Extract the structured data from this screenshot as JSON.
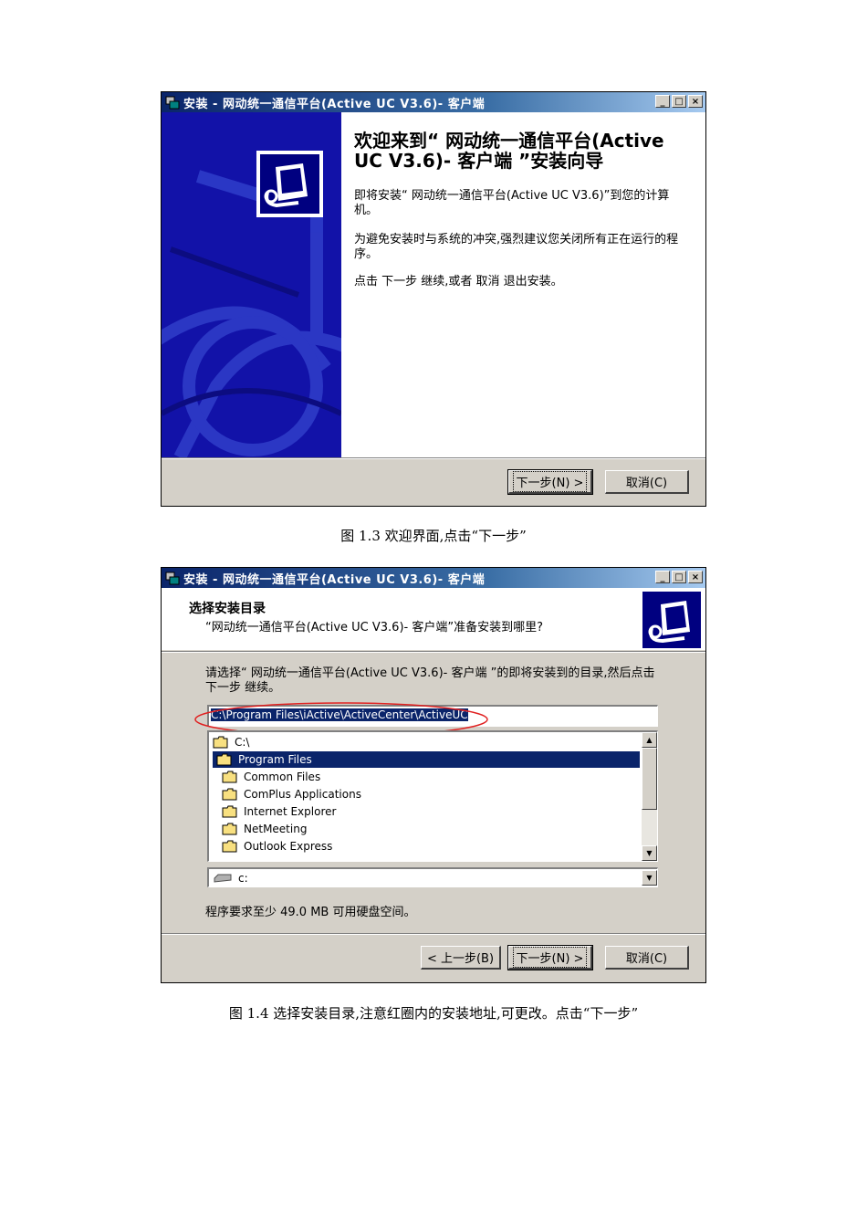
{
  "screenshot1": {
    "window_title": "安装 - 网动统一通信平台(Active UC V3.6)- 客户端",
    "heading": "欢迎来到“ 网动统一通信平台(Active UC V3.6)- 客户端 ”安装向导",
    "para1": "即将安装“ 网动统一通信平台(Active UC V3.6)”到您的计算机。",
    "para2": "为避免安装时与系统的冲突,强烈建议您关闭所有正在运行的程序。",
    "para3": "点击 下一步 继续,或者 取消 退出安装。",
    "next_label": "下一步(N) >",
    "cancel_label": "取消(C)"
  },
  "caption1": "图 1.3 欢迎界面,点击“下一步”",
  "screenshot2": {
    "window_title": "安装 - 网动统一通信平台(Active UC V3.6)- 客户端",
    "title": "选择安装目录",
    "subtitle": "“网动统一通信平台(Active UC V3.6)- 客户端”准备安装到哪里?",
    "prompt": "请选择“ 网动统一通信平台(Active UC V3.6)- 客户端 ”的即将安装到的目录,然后点击 下一步 继续。",
    "path": "C:\\Program Files\\iActive\\ActiveCenter\\ActiveUC",
    "tree": [
      {
        "label": "C:\\",
        "selected": false
      },
      {
        "label": "Program Files",
        "selected": true
      },
      {
        "label": "Common Files",
        "selected": false
      },
      {
        "label": "ComPlus Applications",
        "selected": false
      },
      {
        "label": "Internet Explorer",
        "selected": false
      },
      {
        "label": "NetMeeting",
        "selected": false
      },
      {
        "label": "Outlook Express",
        "selected": false
      }
    ],
    "drive": "c:",
    "space_required": "程序要求至少 49.0 MB 可用硬盘空间。",
    "back_label": "< 上一步(B)",
    "next_label": "下一步(N) >",
    "cancel_label": "取消(C)"
  },
  "caption2": "图 1.4 选择安装目录,注意红圈内的安装地址,可更改。点击“下一步”",
  "colors": {
    "titlebar": "#0a246a",
    "banner": "#1010a0",
    "highlight": "#0a246a",
    "annotation": "#e02020"
  }
}
